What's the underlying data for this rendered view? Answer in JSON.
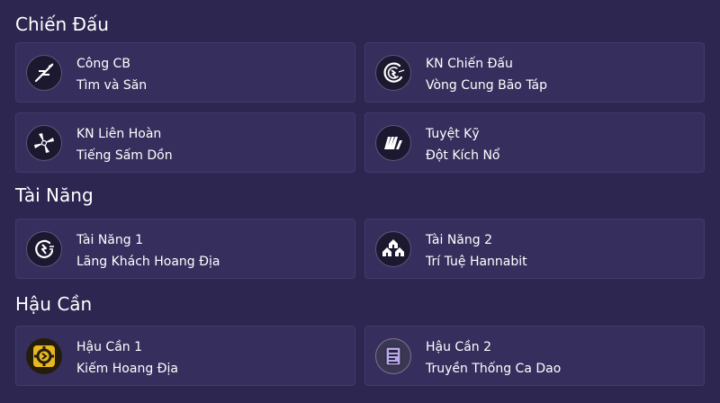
{
  "sections": [
    {
      "title": "Chiến Đấu",
      "cards": [
        {
          "label": "Công CB",
          "value": "Tìm và Săn",
          "icon": "slash-lightning-icon"
        },
        {
          "label": "KN Chiến Đấu",
          "value": "Vòng Cung Bão Táp",
          "icon": "storm-arc-icon"
        },
        {
          "label": "KN Liên Hoàn",
          "value": "Tiếng Sấm Dồn",
          "icon": "spiral-blades-icon"
        },
        {
          "label": "Tuyệt Kỹ",
          "value": "Đột Kích Nổ",
          "icon": "burst-strike-icon"
        }
      ]
    },
    {
      "title": "Tài Năng",
      "cards": [
        {
          "label": "Tài Năng 1",
          "value": "Lãng Khách Hoang Địa",
          "icon": "wanderer-lightning-icon"
        },
        {
          "label": "Tài Năng 2",
          "value": "Trí Tuệ Hannabit",
          "icon": "houses-icon"
        }
      ]
    },
    {
      "title": "Hậu Cần",
      "cards": [
        {
          "label": "Hậu Cần 1",
          "value": "Kiếm Hoang Địa",
          "icon": "gold-gear-icon"
        },
        {
          "label": "Hậu Cần 2",
          "value": "Truyền Thống Ca Dao",
          "icon": "document-icon"
        }
      ]
    }
  ],
  "colors": {
    "background": "#2c2650",
    "card": "#362f5d",
    "card_border": "#423a6c",
    "text": "#ffffff",
    "gold": "#e8b820",
    "lavender": "#b9a9ea"
  }
}
